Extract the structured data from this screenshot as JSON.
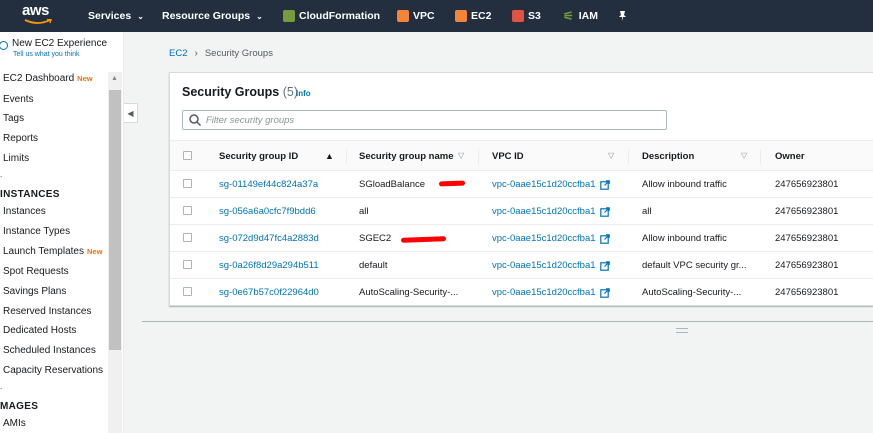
{
  "topnav": {
    "logo_text": "aws",
    "services_label": "Services",
    "resource_groups_label": "Resource Groups",
    "shortcuts": [
      {
        "label": "CloudFormation",
        "icon": "cloudformation-icon",
        "color": "#759c3e"
      },
      {
        "label": "VPC",
        "icon": "vpc-icon",
        "color": "#f58536"
      },
      {
        "label": "EC2",
        "icon": "ec2-icon",
        "color": "#f58536"
      },
      {
        "label": "S3",
        "icon": "s3-icon",
        "color": "#e05243"
      },
      {
        "label": "IAM",
        "icon": "iam-icon",
        "color": "#759c3e"
      }
    ],
    "pin_icon": "pin-icon"
  },
  "sidebar": {
    "new_experience_label": "New EC2 Experience",
    "new_experience_sub": "Tell us what you think",
    "dashboard_label": "EC2 Dashboard",
    "new_badge": "New",
    "top_links": [
      "Events",
      "Tags",
      "Reports",
      "Limits"
    ],
    "instances_heading": "INSTANCES",
    "instance_links": [
      "Instances",
      "Instance Types",
      "Launch Templates",
      "Spot Requests",
      "Savings Plans",
      "Reserved Instances",
      "Dedicated Hosts",
      "Scheduled Instances",
      "Capacity Reservations"
    ],
    "images_heading": "MAGES",
    "image_links": [
      "AMIs"
    ]
  },
  "breadcrumb": {
    "root": "EC2",
    "current": "Security Groups"
  },
  "panel": {
    "title": "Security Groups",
    "count": "(5)",
    "info": "Info",
    "search_placeholder": "Filter security groups"
  },
  "table": {
    "headers": [
      "Security group ID",
      "Security group name",
      "VPC ID",
      "Description",
      "Owner"
    ],
    "rows": [
      {
        "id": "sg-01149ef44c824a37a",
        "name": "SGloadBalance",
        "vpc": "vpc-0aae15c1d20ccfba1",
        "description": "Allow inbound traffic",
        "owner": "247656923801"
      },
      {
        "id": "sg-056a6a0cfc7f9bdd6",
        "name": "all",
        "vpc": "vpc-0aae15c1d20ccfba1",
        "description": "all",
        "owner": "247656923801"
      },
      {
        "id": "sg-072d9d47fc4a2883d",
        "name": "SGEC2",
        "vpc": "vpc-0aae15c1d20ccfba1",
        "description": "Allow inbound traffic",
        "owner": "247656923801"
      },
      {
        "id": "sg-0a26f8d29a294b511",
        "name": "default",
        "vpc": "vpc-0aae15c1d20ccfba1",
        "description": "default VPC security gr...",
        "owner": "247656923801"
      },
      {
        "id": "sg-0e67b57c0f22964d0",
        "name": "AutoScaling-Security-...",
        "vpc": "vpc-0aae15c1d20ccfba1",
        "description": "AutoScaling-Security-...",
        "owner": "247656923801"
      }
    ]
  },
  "colors": {
    "nav_bg": "#232f3e",
    "link": "#0073bb",
    "badge": "#ec7211",
    "redaction": "#ff0000"
  }
}
